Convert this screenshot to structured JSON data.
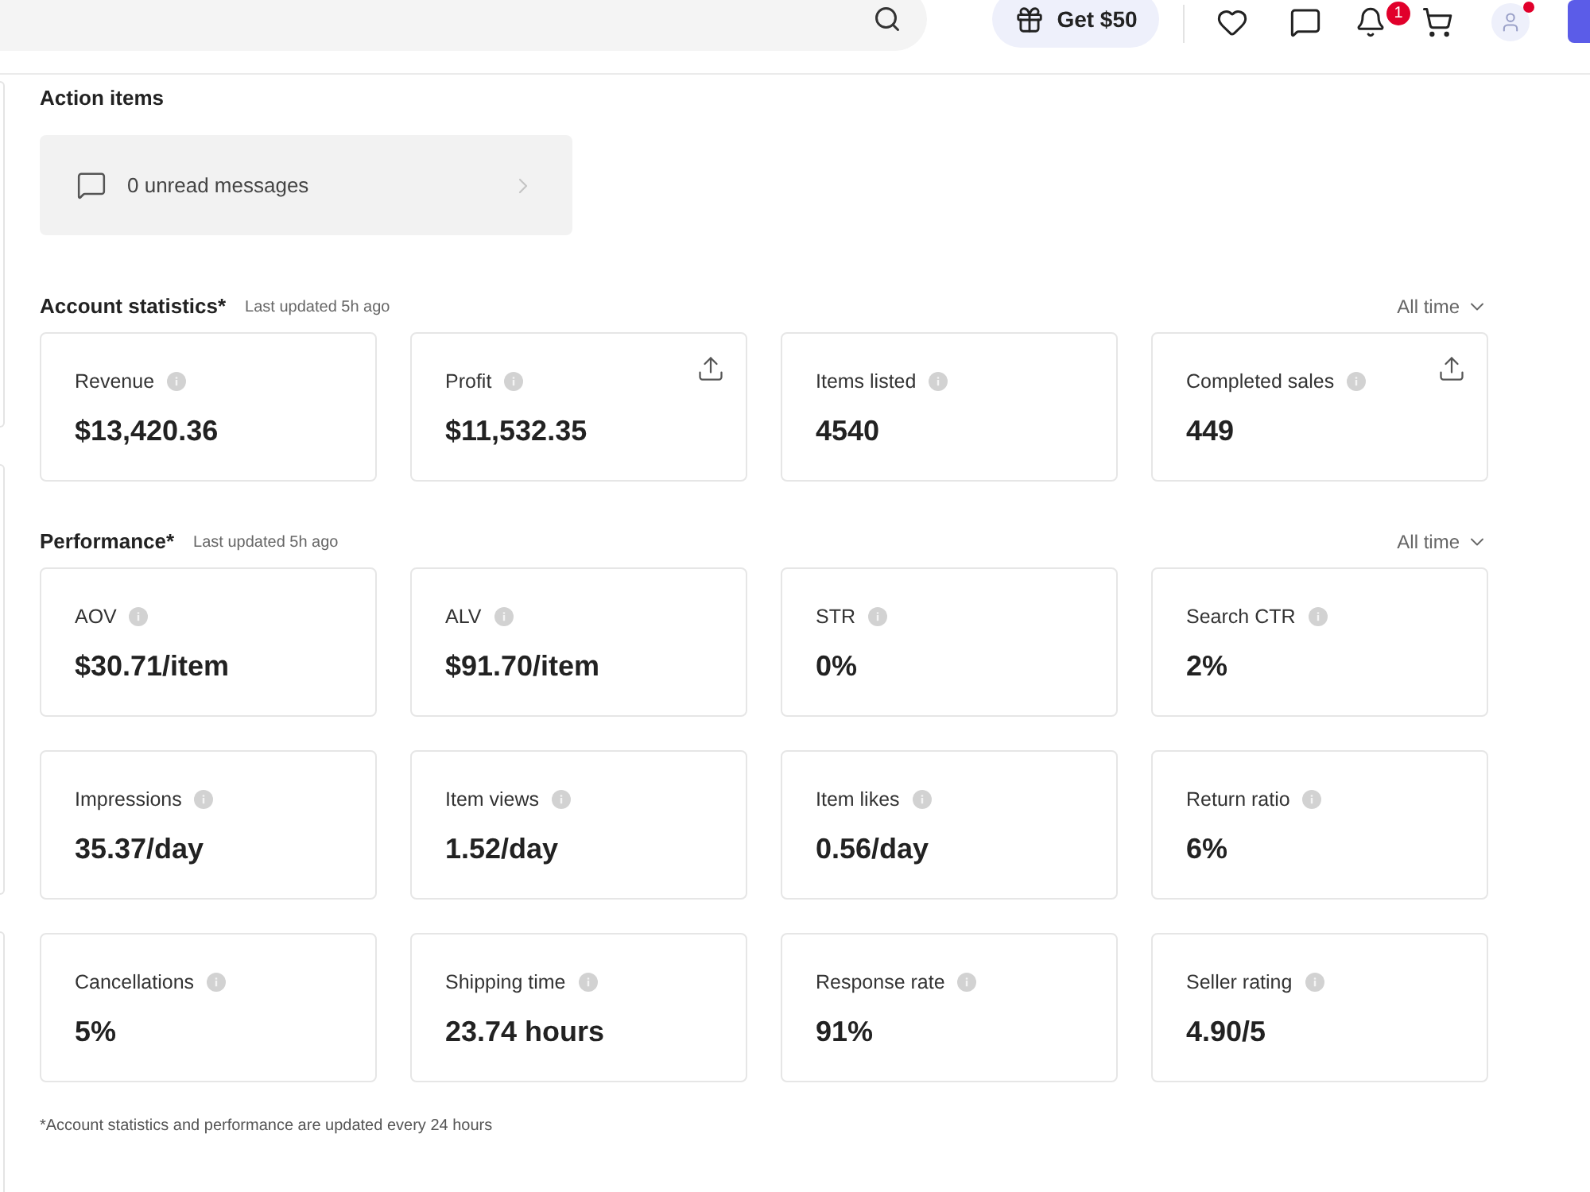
{
  "header": {
    "promo": {
      "label": "Get $50"
    },
    "notifications": {
      "badge": "1"
    },
    "account": {
      "alert": true
    }
  },
  "action_items": {
    "title": "Action items",
    "items": [
      {
        "kind": "messages",
        "label": "0 unread messages"
      }
    ]
  },
  "sections": [
    {
      "title": "Account statistics*",
      "updated": "Last updated 5h ago",
      "period": "All time",
      "cards": [
        {
          "label": "Revenue",
          "value": "$13,420.36",
          "export": false
        },
        {
          "label": "Profit",
          "value": "$11,532.35",
          "export": true
        },
        {
          "label": "Items listed",
          "value": "4540",
          "export": false
        },
        {
          "label": "Completed sales",
          "value": "449",
          "export": true
        }
      ]
    },
    {
      "title": "Performance*",
      "updated": "Last updated 5h ago",
      "period": "All time",
      "cards": [
        {
          "label": "AOV",
          "value": "$30.71/item",
          "export": false
        },
        {
          "label": "ALV",
          "value": "$91.70/item",
          "export": false
        },
        {
          "label": "STR",
          "value": "0%",
          "export": false
        },
        {
          "label": "Search CTR",
          "value": "2%",
          "export": false
        },
        {
          "label": "Impressions",
          "value": "35.37/day",
          "export": false
        },
        {
          "label": "Item views",
          "value": "1.52/day",
          "export": false
        },
        {
          "label": "Item likes",
          "value": "0.56/day",
          "export": false
        },
        {
          "label": "Return ratio",
          "value": "6%",
          "export": false
        },
        {
          "label": "Cancellations",
          "value": "5%",
          "export": false
        },
        {
          "label": "Shipping time",
          "value": "23.74 hours",
          "export": false
        },
        {
          "label": "Response rate",
          "value": "91%",
          "export": false
        },
        {
          "label": "Seller rating",
          "value": "4.90/5",
          "export": false
        }
      ]
    }
  ],
  "footnote": "*Account statistics and performance are updated every 24 hours"
}
